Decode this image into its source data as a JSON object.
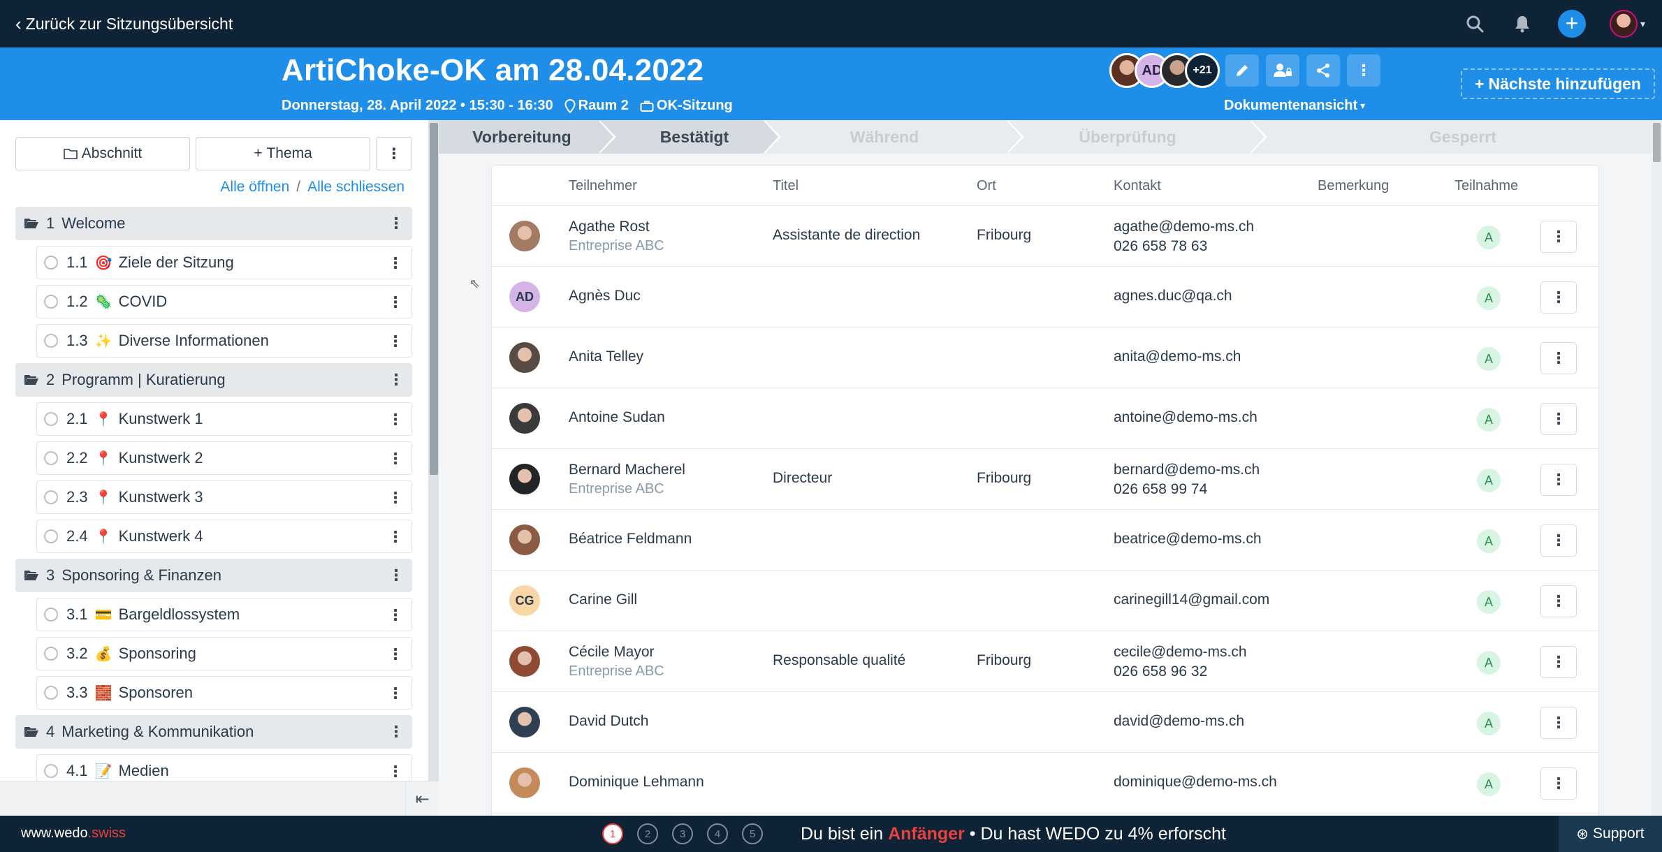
{
  "topbar": {
    "back_label": "Zurück zur Sitzungsübersicht"
  },
  "header": {
    "title": "ArtiChoke-OK am 28.04.2022",
    "datetime": "Donnerstag, 28. April 2022 • 15:30 - 16:30",
    "room": "Raum 2",
    "meeting_type": "OK-Sitzung",
    "avatar_initials": "AD",
    "more_count": "+21",
    "document_view_label": "Dokumentenansicht",
    "add_next_label": "Nächste hinzufügen"
  },
  "left": {
    "section_btn": "Abschnitt",
    "topic_btn": "Thema",
    "open_all": "Alle öffnen",
    "link_sep": "/",
    "close_all": "Alle schliessen",
    "agenda": [
      {
        "num": "1",
        "label": "Welcome",
        "items": [
          {
            "num": "1.1",
            "emoji": "🎯",
            "label": "Ziele der Sitzung"
          },
          {
            "num": "1.2",
            "emoji": "🦠",
            "label": "COVID"
          },
          {
            "num": "1.3",
            "emoji": "✨",
            "label": "Diverse Informationen"
          }
        ]
      },
      {
        "num": "2",
        "label": "Programm | Kuratierung",
        "items": [
          {
            "num": "2.1",
            "emoji": "📍",
            "label": "Kunstwerk 1"
          },
          {
            "num": "2.2",
            "emoji": "📍",
            "label": "Kunstwerk 2"
          },
          {
            "num": "2.3",
            "emoji": "📍",
            "label": "Kunstwerk 3"
          },
          {
            "num": "2.4",
            "emoji": "📍",
            "label": "Kunstwerk 4"
          }
        ]
      },
      {
        "num": "3",
        "label": "Sponsoring & Finanzen",
        "items": [
          {
            "num": "3.1",
            "emoji": "💳",
            "label": "Bargeldlossystem"
          },
          {
            "num": "3.2",
            "emoji": "💰",
            "label": "Sponsoring"
          },
          {
            "num": "3.3",
            "emoji": "🧱",
            "label": "Sponsoren"
          }
        ]
      },
      {
        "num": "4",
        "label": "Marketing & Kommunikation",
        "items": [
          {
            "num": "4.1",
            "emoji": "📝",
            "label": "Medien"
          }
        ]
      }
    ]
  },
  "steps": [
    "Vorbereitung",
    "Bestätigt",
    "Während",
    "Überprüfung",
    "Gesperrt"
  ],
  "table": {
    "headers": {
      "participant": "Teilnehmer",
      "title": "Titel",
      "location": "Ort",
      "contact": "Kontakt",
      "remark": "Bemerkung",
      "attendance": "Teilnahme"
    },
    "rows": [
      {
        "name": "Agathe Rost",
        "org": "Entreprise ABC",
        "title": "Assistante de direction",
        "location": "Fribourg",
        "email": "agathe@demo-ms.ch",
        "phone": "026 658 78 63",
        "att": "A",
        "initials": "",
        "avatar_color": "#a47a62"
      },
      {
        "name": "Agnès Duc",
        "org": "",
        "title": "",
        "location": "",
        "email": "agnes.duc@qa.ch",
        "phone": "",
        "att": "A",
        "initials": "AD",
        "avatar_color": "#d4b4e6"
      },
      {
        "name": "Anita Telley",
        "org": "",
        "title": "",
        "location": "",
        "email": "anita@demo-ms.ch",
        "phone": "",
        "att": "A",
        "initials": "",
        "avatar_color": "#5a4a44"
      },
      {
        "name": "Antoine Sudan",
        "org": "",
        "title": "",
        "location": "",
        "email": "antoine@demo-ms.ch",
        "phone": "",
        "att": "A",
        "initials": "",
        "avatar_color": "#3a3a3a"
      },
      {
        "name": "Bernard Macherel",
        "org": "Entreprise ABC",
        "title": "Directeur",
        "location": "Fribourg",
        "email": "bernard@demo-ms.ch",
        "phone": "026 658 99 74",
        "att": "A",
        "initials": "",
        "avatar_color": "#222426"
      },
      {
        "name": "Béatrice Feldmann",
        "org": "",
        "title": "",
        "location": "",
        "email": "beatrice@demo-ms.ch",
        "phone": "",
        "att": "A",
        "initials": "",
        "avatar_color": "#8a5a42"
      },
      {
        "name": "Carine Gill",
        "org": "",
        "title": "",
        "location": "",
        "email": "carinegill14@gmail.com",
        "phone": "",
        "att": "A",
        "initials": "CG",
        "avatar_color": "#f8d6a6"
      },
      {
        "name": "Cécile Mayor",
        "org": "Entreprise ABC",
        "title": "Responsable qualité",
        "location": "Fribourg",
        "email": "cecile@demo-ms.ch",
        "phone": "026 658 96 32",
        "att": "A",
        "initials": "",
        "avatar_color": "#8e4a32"
      },
      {
        "name": "David Dutch",
        "org": "",
        "title": "",
        "location": "",
        "email": "david@demo-ms.ch",
        "phone": "",
        "att": "A",
        "initials": "",
        "avatar_color": "#2f4054"
      },
      {
        "name": "Dominique Lehmann",
        "org": "",
        "title": "",
        "location": "",
        "email": "dominique@demo-ms.ch",
        "phone": "",
        "att": "A",
        "initials": "",
        "avatar_color": "#c48a5a"
      }
    ]
  },
  "footer": {
    "brand_main": "www.wedo",
    "brand_suffix": ".swiss",
    "step_dots": [
      "1",
      "2",
      "3",
      "4",
      "5"
    ],
    "progress_prefix": "Du bist ein ",
    "progress_level": "Anfänger",
    "progress_suffix": " • Du hast WEDO zu 4% erforscht",
    "support_label": "Support"
  },
  "colors": {
    "topbar": "#0e2436",
    "header": "#1f8ee8",
    "accent": "#1f8ee8",
    "level": "#e8413e",
    "attendance_bg": "#d7f5e2",
    "attendance_fg": "#2d8e54"
  }
}
